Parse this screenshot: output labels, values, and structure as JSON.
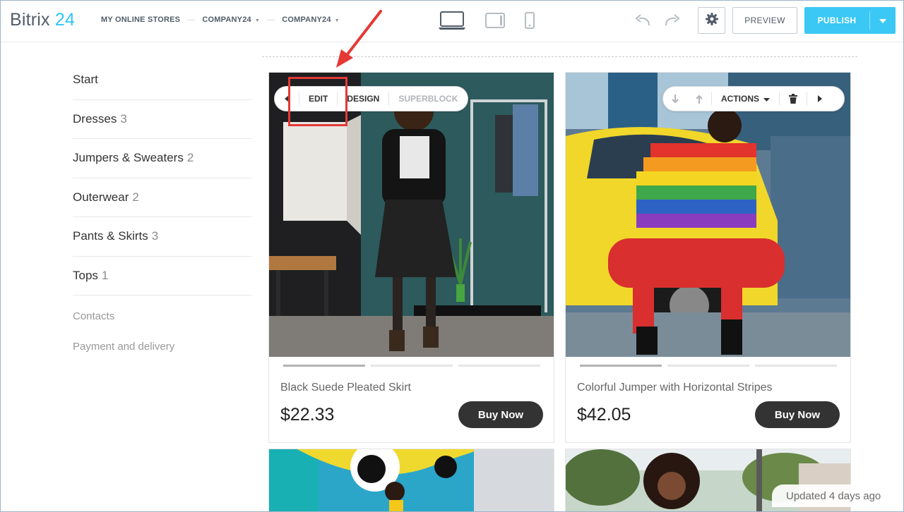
{
  "header": {
    "logo_text": "Bitrix",
    "logo_num": "24",
    "breadcrumbs": [
      "MY ONLINE STORES",
      "COMPANY24",
      "COMPANY24"
    ],
    "preview_label": "PREVIEW",
    "publish_label": "PUBLISH",
    "icons": [
      "desktop-icon",
      "tablet-icon",
      "mobile-icon",
      "undo-icon",
      "redo-icon",
      "gear-icon",
      "caret-down-icon"
    ]
  },
  "nav": {
    "items": [
      {
        "label": "Start",
        "count": ""
      },
      {
        "label": "Dresses",
        "count": "3"
      },
      {
        "label": "Jumpers & Sweaters",
        "count": "2"
      },
      {
        "label": "Outerwear",
        "count": "2"
      },
      {
        "label": "Pants & Skirts",
        "count": "3"
      },
      {
        "label": "Tops",
        "count": "1"
      }
    ],
    "links": [
      "Contacts",
      "Payment and delivery"
    ]
  },
  "block_toolbar_left": {
    "edit": "EDIT",
    "design": "DESIGN",
    "superblock": "SUPERBLOCK"
  },
  "block_toolbar_right": {
    "actions": "ACTIONS"
  },
  "products": [
    {
      "name": "Black Suede Pleated Skirt",
      "price": "$22.33",
      "button": "Buy Now"
    },
    {
      "name": "Colorful Jumper with Horizontal Stripes",
      "price": "$42.05",
      "button": "Buy Now"
    }
  ],
  "status": {
    "updated": "Updated 4 days ago"
  },
  "colors": {
    "accent": "#3bc8f5",
    "highlight": "#e53935",
    "button_dark": "#333333"
  }
}
